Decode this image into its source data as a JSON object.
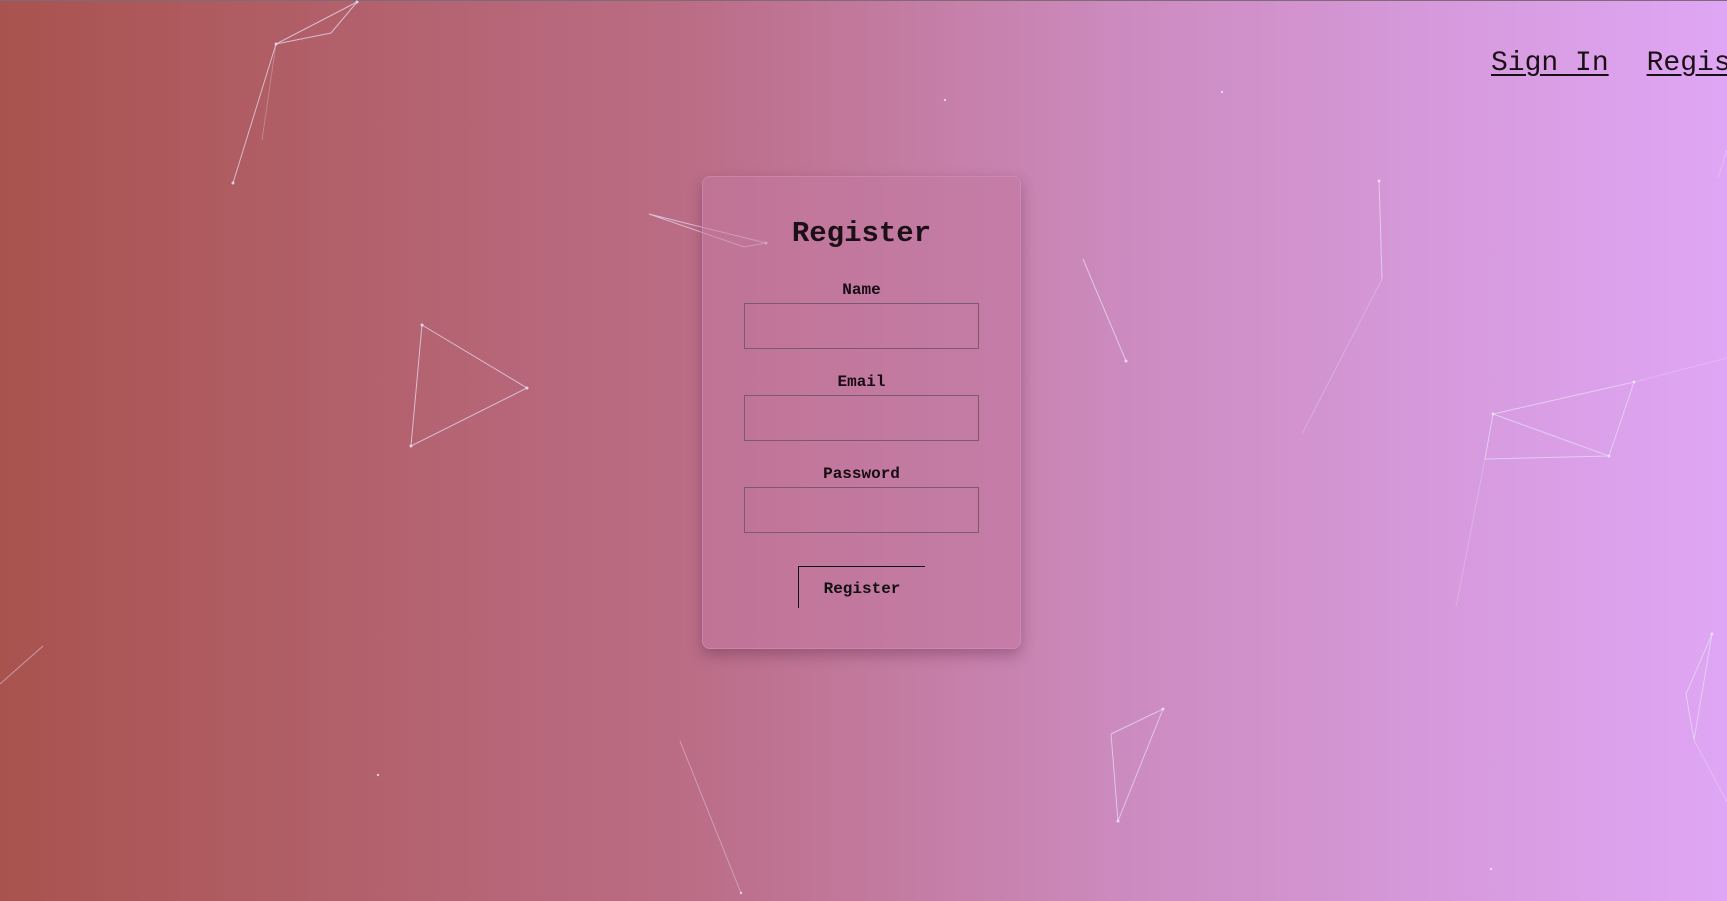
{
  "nav": {
    "sign_in": "Sign In",
    "register": "Register"
  },
  "form": {
    "title": "Register",
    "name_label": "Name",
    "email_label": "Email",
    "password_label": "Password",
    "name_value": "",
    "email_value": "",
    "password_value": "",
    "submit_label": "Register"
  },
  "colors": {
    "gradient_start": "#a9534f",
    "gradient_end": "#dfa6f5",
    "network_line": "#e3d6f2"
  }
}
